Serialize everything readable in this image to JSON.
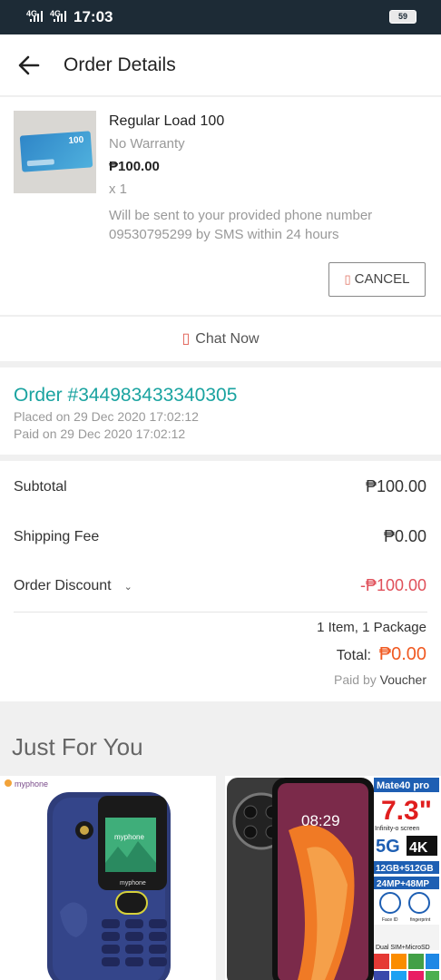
{
  "status_bar": {
    "signal1": "4G",
    "signal2": "4G",
    "time": "17:03",
    "battery": "59"
  },
  "header": {
    "title": "Order Details"
  },
  "product": {
    "name": "Regular Load 100",
    "warranty": "No Warranty",
    "price": "₱100.00",
    "quantity": "x 1",
    "note": "Will be sent to your provided phone number 09530795299 by SMS within 24 hours",
    "cancel_label": "CANCEL",
    "card_text": "100"
  },
  "chat": {
    "label": "Chat Now"
  },
  "order": {
    "number": "Order #344983433340305",
    "placed": "Placed on 29 Dec 2020  17:02:12",
    "paid": "Paid on 29 Dec 2020  17:02:12"
  },
  "summary": {
    "subtotal_label": "Subtotal",
    "subtotal_value": "₱100.00",
    "shipping_label": "Shipping Fee",
    "shipping_value": "₱0.00",
    "discount_label": "Order Discount",
    "discount_value": "-₱100.00",
    "items": "1 Item, 1 Package",
    "total_label": "Total:",
    "total_value": "₱0.00",
    "paid_by_label": "Paid by",
    "paid_by_value": "Voucher"
  },
  "just_for_you": {
    "title": "Just For You",
    "product1": {
      "brand": "myphone",
      "screen_brand": "myphone"
    },
    "product2": {
      "model": "Mate40 pro",
      "size": "7.3\"",
      "tagline": "Infinity-o screen",
      "badges": [
        "5G",
        "4K"
      ],
      "memory": "12GB+512GB",
      "camera": "24MP+48MP",
      "sim": "Dual SIM+MicroSD",
      "clock": "08:29",
      "face_id": "Face ID",
      "fingerprint": "fingerprint"
    }
  },
  "colors": {
    "accent_teal": "#1aa3a0",
    "total_orange": "#f05a22",
    "discount_red": "#e0505a",
    "status_bar": "#1d2b36"
  }
}
